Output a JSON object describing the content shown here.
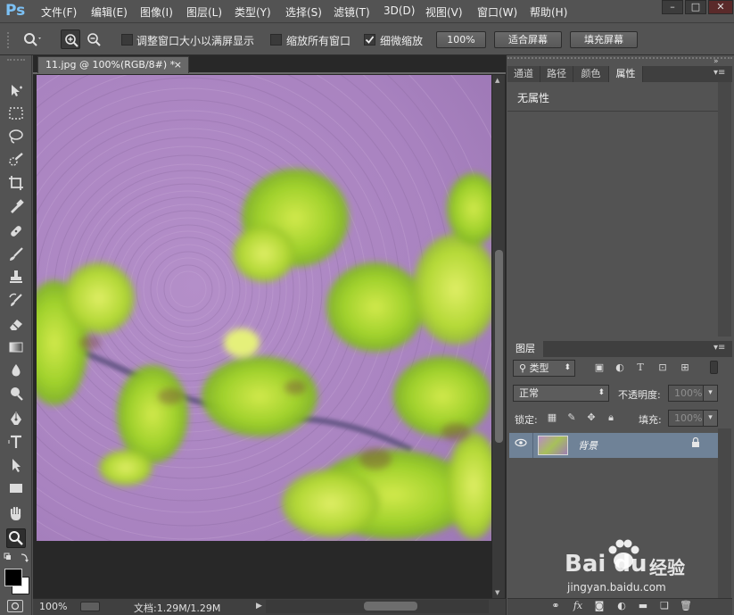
{
  "app": {
    "logo": "Ps"
  },
  "menu": [
    "文件(F)",
    "编辑(E)",
    "图像(I)",
    "图层(L)",
    "类型(Y)",
    "选择(S)",
    "滤镜(T)",
    "3D(D)",
    "视图(V)",
    "窗口(W)",
    "帮助(H)"
  ],
  "window_controls": {
    "minimize": "–",
    "maximize": "□",
    "close": "✕"
  },
  "options": {
    "resize_windows_label": "调整窗口大小以满屏显示",
    "zoom_all_label": "缩放所有窗口",
    "scrubby_zoom_label": "细微缩放",
    "scrubby_zoom_checked": true,
    "btn_100": "100%",
    "btn_fit": "适合屏幕",
    "btn_fill": "填充屏幕"
  },
  "document": {
    "tab_title": "11.jpg @ 100%(RGB/8#) *",
    "tab_close": "×",
    "zoom": "100%",
    "doc_size": "文档:1.29M/1.29M"
  },
  "props_panel": {
    "tabs": [
      "通道",
      "路径",
      "颜色",
      "属性"
    ],
    "active_tab": "属性",
    "title": "无属性"
  },
  "layers_panel": {
    "tab": "图层",
    "filter_kind": "类型",
    "blend_mode": "正常",
    "opacity_label": "不透明度:",
    "opacity_value": "100%",
    "lock_label": "锁定:",
    "fill_label": "填充:",
    "fill_value": "100%",
    "layer_name": "背景"
  },
  "watermark": {
    "brand": "Bai du",
    "cn": "经验",
    "url": "jingyan.baidu.com"
  },
  "icons": {
    "zoom_tool": "magnifier-icon",
    "move_tool": "move-icon",
    "eye": "eye-icon",
    "lock": "lock-icon"
  }
}
